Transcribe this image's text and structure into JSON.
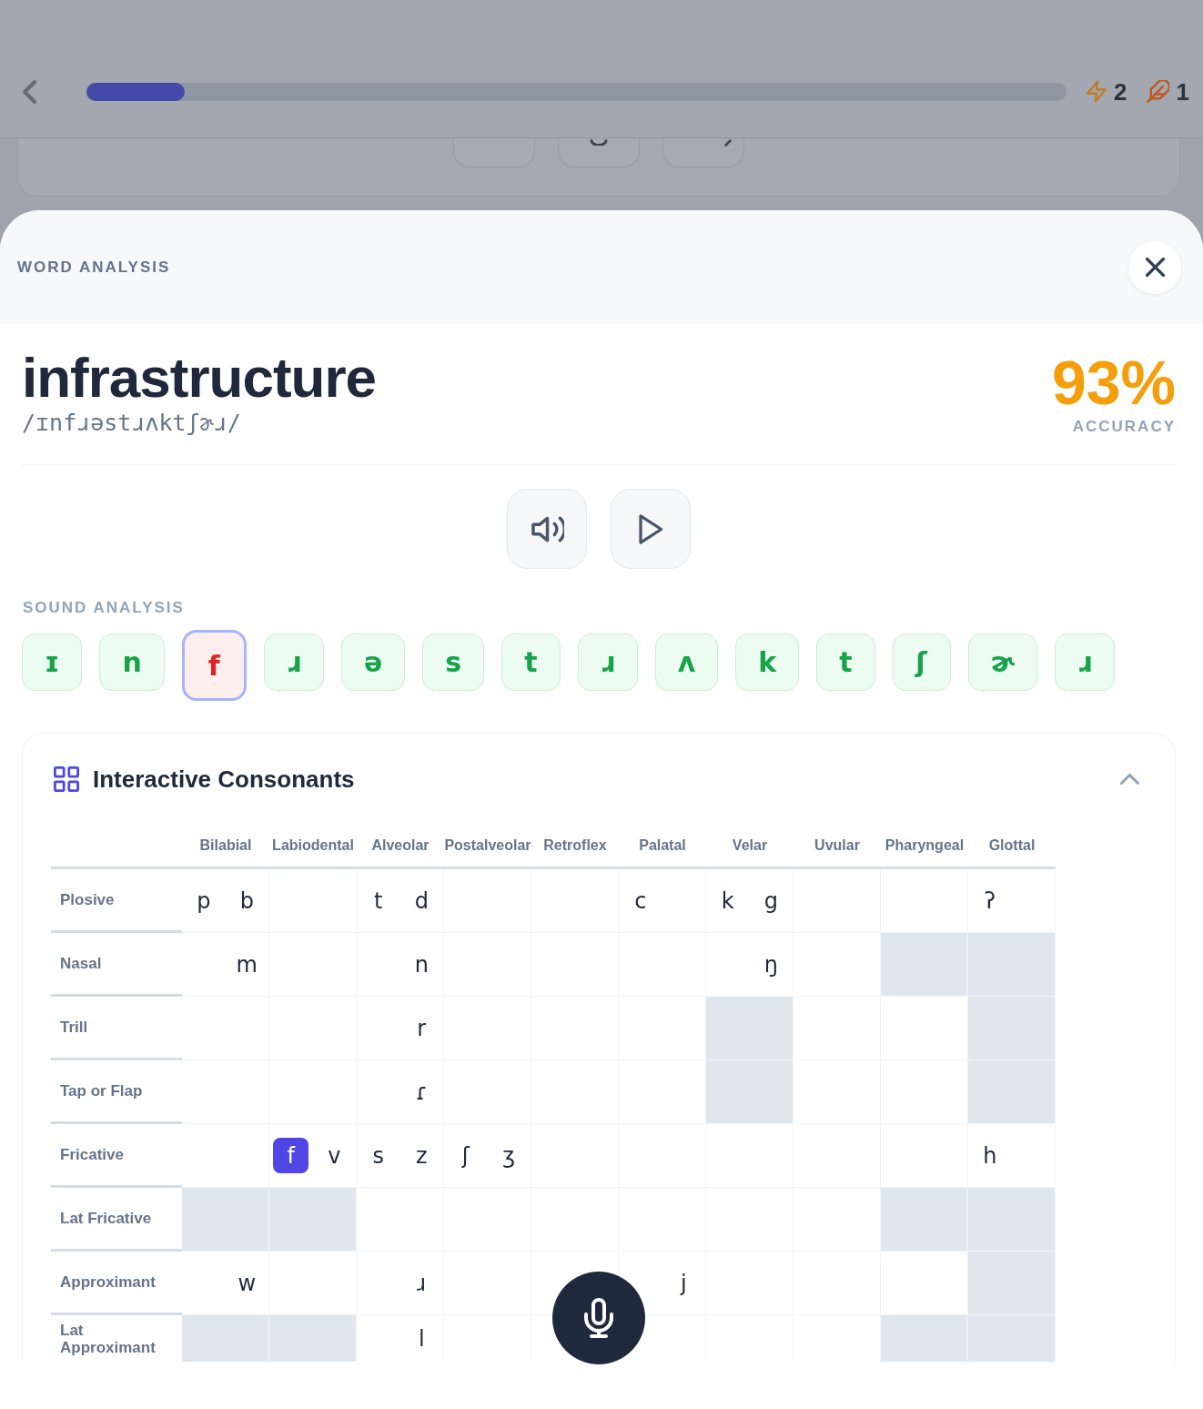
{
  "top_bar": {
    "progress": {
      "level": 0.1
    },
    "counters": [
      {
        "kind": "bolt",
        "value": "2"
      },
      {
        "kind": "feather",
        "value": "1"
      }
    ]
  },
  "sheet": {
    "title": "WORD ANALYSIS",
    "word": "infrastructure",
    "transcription": "/ɪnfɹəstɹʌktʃɚɹ/",
    "score": "93%",
    "score_label": "ACCURACY"
  },
  "sound_analysis": {
    "title": "SOUND ANALYSIS",
    "phonemes": [
      {
        "symbol": "ɪ",
        "correct": true,
        "selected": false
      },
      {
        "symbol": "n",
        "correct": true,
        "selected": false
      },
      {
        "symbol": "f",
        "correct": false,
        "selected": true
      },
      {
        "symbol": "ɹ",
        "correct": true,
        "selected": false
      },
      {
        "symbol": "ə",
        "correct": true,
        "selected": false
      },
      {
        "symbol": "s",
        "correct": true,
        "selected": false
      },
      {
        "symbol": "t",
        "correct": true,
        "selected": false
      },
      {
        "symbol": "ɹ",
        "correct": true,
        "selected": false
      },
      {
        "symbol": "ʌ",
        "correct": true,
        "selected": false
      },
      {
        "symbol": "k",
        "correct": true,
        "selected": false
      },
      {
        "symbol": "t",
        "correct": true,
        "selected": false
      },
      {
        "symbol": "ʃ",
        "correct": true,
        "selected": false
      },
      {
        "symbol": "ɚ",
        "correct": true,
        "selected": false
      },
      {
        "symbol": "ɹ",
        "correct": true,
        "selected": false
      }
    ]
  },
  "consonants": {
    "title": "Interactive Consonants",
    "expanded": true,
    "columns": [
      "Bilabial",
      "Labiodental",
      "Alveolar",
      "Postalveolar",
      "Retroflex",
      "Palatal",
      "Velar",
      "Uvular",
      "Pharyngeal",
      "Glottal"
    ],
    "rows": [
      {
        "label": "Plosive",
        "cells": [
          {
            "shaded": false,
            "left": {
              "symbol": "p",
              "selected": false
            },
            "right": {
              "symbol": "b",
              "selected": false
            }
          },
          {
            "shaded": false
          },
          {
            "shaded": false,
            "left": {
              "symbol": "t",
              "selected": false
            },
            "right": {
              "symbol": "d",
              "selected": false
            }
          },
          {
            "shaded": false
          },
          {
            "shaded": false
          },
          {
            "shaded": false,
            "left": {
              "symbol": "c",
              "selected": false
            }
          },
          {
            "shaded": false,
            "left": {
              "symbol": "k",
              "selected": false
            },
            "right": {
              "symbol": "g",
              "selected": false
            }
          },
          {
            "shaded": false
          },
          {
            "shaded": false
          },
          {
            "shaded": false,
            "left": {
              "symbol": "ʔ",
              "selected": false
            }
          }
        ]
      },
      {
        "label": "Nasal",
        "cells": [
          {
            "shaded": false,
            "right": {
              "symbol": "m",
              "selected": false
            }
          },
          {
            "shaded": false
          },
          {
            "shaded": false,
            "right": {
              "symbol": "n",
              "selected": false
            }
          },
          {
            "shaded": false
          },
          {
            "shaded": false
          },
          {
            "shaded": false
          },
          {
            "shaded": false,
            "right": {
              "symbol": "ŋ",
              "selected": false
            }
          },
          {
            "shaded": false
          },
          {
            "shaded": true
          },
          {
            "shaded": true
          }
        ]
      },
      {
        "label": "Trill",
        "cells": [
          {
            "shaded": false
          },
          {
            "shaded": false
          },
          {
            "shaded": false,
            "right": {
              "symbol": "r",
              "selected": false
            }
          },
          {
            "shaded": false
          },
          {
            "shaded": false
          },
          {
            "shaded": false
          },
          {
            "shaded": true
          },
          {
            "shaded": false
          },
          {
            "shaded": false
          },
          {
            "shaded": true
          }
        ]
      },
      {
        "label": "Tap or Flap",
        "cells": [
          {
            "shaded": false
          },
          {
            "shaded": false
          },
          {
            "shaded": false,
            "right": {
              "symbol": "ɾ",
              "selected": false
            }
          },
          {
            "shaded": false
          },
          {
            "shaded": false
          },
          {
            "shaded": false
          },
          {
            "shaded": true
          },
          {
            "shaded": false
          },
          {
            "shaded": false
          },
          {
            "shaded": true
          }
        ]
      },
      {
        "label": "Fricative",
        "cells": [
          {
            "shaded": false
          },
          {
            "shaded": false,
            "left": {
              "symbol": "f",
              "selected": true
            },
            "right": {
              "symbol": "v",
              "selected": false
            }
          },
          {
            "shaded": false,
            "left": {
              "symbol": "s",
              "selected": false
            },
            "right": {
              "symbol": "z",
              "selected": false
            }
          },
          {
            "shaded": false,
            "left": {
              "symbol": "ʃ",
              "selected": false
            },
            "right": {
              "symbol": "ʒ",
              "selected": false
            }
          },
          {
            "shaded": false
          },
          {
            "shaded": false
          },
          {
            "shaded": false
          },
          {
            "shaded": false
          },
          {
            "shaded": false
          },
          {
            "shaded": false,
            "left": {
              "symbol": "h",
              "selected": false
            }
          }
        ]
      },
      {
        "label": "Lat Fricative",
        "cells": [
          {
            "shaded": true
          },
          {
            "shaded": true
          },
          {
            "shaded": false
          },
          {
            "shaded": false
          },
          {
            "shaded": false
          },
          {
            "shaded": false
          },
          {
            "shaded": false
          },
          {
            "shaded": false
          },
          {
            "shaded": true
          },
          {
            "shaded": true
          }
        ]
      },
      {
        "label": "Approximant",
        "cells": [
          {
            "shaded": false,
            "right": {
              "symbol": "w",
              "selected": false
            }
          },
          {
            "shaded": false
          },
          {
            "shaded": false,
            "right": {
              "symbol": "ɹ",
              "selected": false
            }
          },
          {
            "shaded": false
          },
          {
            "shaded": false
          },
          {
            "shaded": false,
            "right": {
              "symbol": "j",
              "selected": false
            }
          },
          {
            "shaded": false
          },
          {
            "shaded": false
          },
          {
            "shaded": false
          },
          {
            "shaded": true
          }
        ]
      },
      {
        "label": "Lat Approximant",
        "cells": [
          {
            "shaded": true
          },
          {
            "shaded": true
          },
          {
            "shaded": false,
            "right": {
              "symbol": "l",
              "selected": false
            }
          },
          {
            "shaded": false
          },
          {
            "shaded": false
          },
          {
            "shaded": false
          },
          {
            "shaded": false
          },
          {
            "shaded": false
          },
          {
            "shaded": true
          },
          {
            "shaded": true
          }
        ]
      }
    ]
  }
}
